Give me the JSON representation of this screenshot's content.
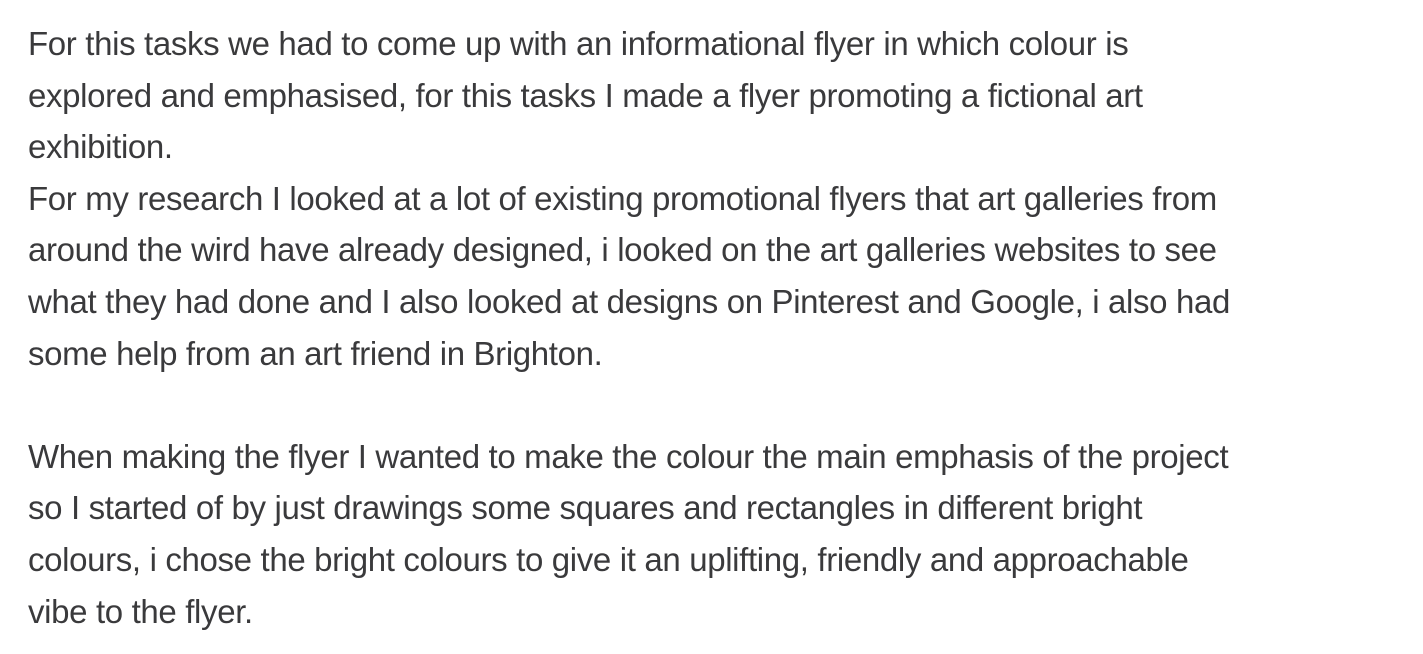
{
  "note": {
    "paragraph_1": [
      "For this tasks we had to come up with an informational flyer in which colour is",
      "explored and emphasised, for this tasks I made a flyer promoting a fictional art",
      "exhibition."
    ],
    "paragraph_2": [
      "For my research I looked at a lot of existing promotional flyers that art galleries from",
      "around the wird have already designed, i looked on the art galleries websites to see",
      "what they had done and I also looked at designs on Pinterest and Google, i also had",
      "some help from an art friend in Brighton."
    ],
    "paragraph_3": [
      "When making the flyer I wanted to make the colour the main emphasis of the project",
      "so I started of by just drawings some squares and rectangles in different bright",
      "colours, i chose the bright colours to give it an uplifting, friendly and approachable",
      "vibe to the flyer."
    ]
  }
}
